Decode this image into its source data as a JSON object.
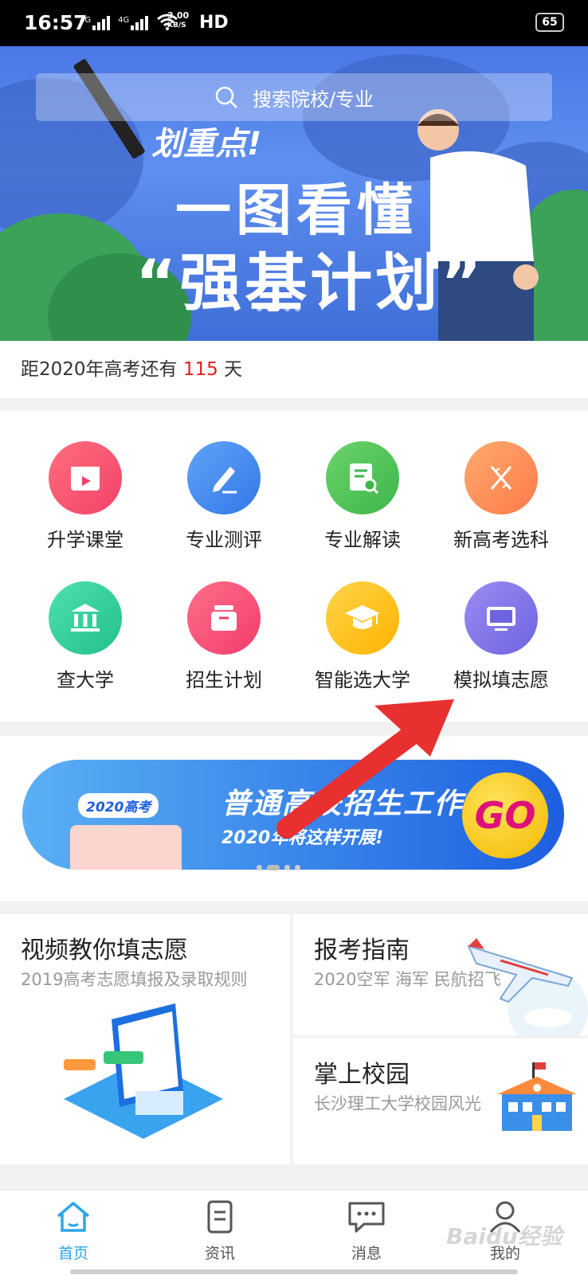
{
  "status_bar": {
    "time": "16:57",
    "network1": "4G",
    "network2": "4G",
    "speed_value": "3.00",
    "speed_unit": "KB/S",
    "hd": "HD",
    "battery": "65"
  },
  "hero": {
    "search_placeholder": "搜索院校/专业",
    "tag": "划重点!",
    "headline1": "一图看懂",
    "headline2": "“强基计划”",
    "dot_count": 4,
    "active_dot": 1
  },
  "countdown": {
    "prefix": "距2020年高考还有 ",
    "days": "115",
    "suffix": " 天"
  },
  "apps": [
    {
      "label": "升学课堂",
      "color_from": "#ff6f7d",
      "color_to": "#f2416a",
      "icon": "video-play-icon"
    },
    {
      "label": "专业测评",
      "color_from": "#5fa4f7",
      "color_to": "#3378e8",
      "icon": "pencil-icon"
    },
    {
      "label": "专业解读",
      "color_from": "#6bd36b",
      "color_to": "#3db64b",
      "icon": "document-search-icon"
    },
    {
      "label": "新高考选科",
      "color_from": "#ffaa6e",
      "color_to": "#ff7a4a",
      "icon": "dna-icon"
    },
    {
      "label": "查大学",
      "color_from": "#4fe0b0",
      "color_to": "#22c08a",
      "icon": "university-building-icon"
    },
    {
      "label": "招生计划",
      "color_from": "#ff6f8a",
      "color_to": "#f23c6b",
      "icon": "inbox-box-icon"
    },
    {
      "label": "智能选大学",
      "color_from": "#ffd54a",
      "color_to": "#ffb300",
      "icon": "graduation-cap-icon"
    },
    {
      "label": "模拟填志愿",
      "color_from": "#9a8cf2",
      "color_to": "#6e64e0",
      "icon": "monitor-icon"
    }
  ],
  "promo": {
    "badge": "2020高考",
    "title": "普通高校招生工作",
    "subtitle": "2020年将这样开展!",
    "go": "GO",
    "dot_count": 4,
    "active_dot": 1
  },
  "cards": {
    "video": {
      "title": "视频教你填志愿",
      "subtitle": "2019高考志愿填报及录取规则"
    },
    "guide": {
      "title": "报考指南",
      "subtitle": "2020空军 海军 民航招飞"
    },
    "campus": {
      "title": "掌上校园",
      "subtitle": "长沙理工大学校园风光"
    }
  },
  "tabs": [
    {
      "label": "首页",
      "icon": "home-icon",
      "active": true
    },
    {
      "label": "资讯",
      "icon": "news-document-icon",
      "active": false
    },
    {
      "label": "消息",
      "icon": "message-bubble-icon",
      "active": false
    },
    {
      "label": "我的",
      "icon": "profile-person-icon",
      "active": false
    }
  ],
  "watermark": "Baidu经验"
}
